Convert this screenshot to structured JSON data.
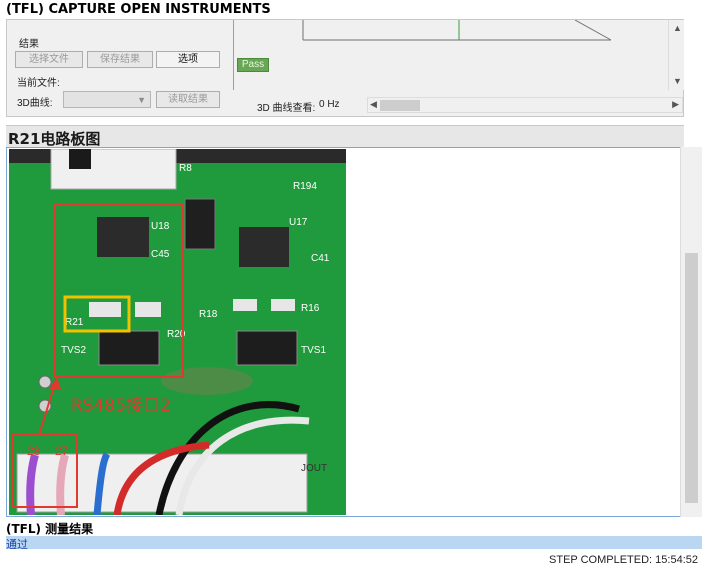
{
  "window": {
    "step_title": "(TFL) CAPTURE OPEN INSTRUMENTS"
  },
  "instrument_panel": {
    "result_label": "结果",
    "select_file_button": "选择文件",
    "save_result_button": "保存结果",
    "options_button": "选项",
    "current_file_label": "当前文件:",
    "curve3d_label": "3D曲线:",
    "curve3d_select_value": "",
    "read_result_button": "读取结果",
    "pass_indicator": "Pass",
    "curve3d_freq_label": "3D 曲线查看:",
    "curve3d_freq_value": "0 Hz"
  },
  "section": {
    "title": "R21电路板图"
  },
  "photo": {
    "labels": {
      "u18": "U18",
      "c45": "C45",
      "u17": "U17",
      "c41": "C41",
      "r18": "R18",
      "r16": "R16",
      "r21": "R21",
      "r20": "R20",
      "tvs2": "TVS2",
      "tvs1": "TVS1",
      "r194": "R194",
      "r8": "R8",
      "jout": "JOUT",
      "rs485": "RS485接口2",
      "pin28": "28",
      "pin27": "27"
    }
  },
  "results": {
    "title": "(TFL) 测量结果",
    "value": "通过"
  },
  "footer": {
    "status": "STEP COMPLETED: 15:54:52"
  },
  "colors": {
    "pcb_green": "#1f9a3c",
    "highlight_red": "#e03a2e",
    "highlight_yellow": "#f2c200",
    "selection_blue": "#b9d7f2",
    "pass_green": "#69a655"
  }
}
